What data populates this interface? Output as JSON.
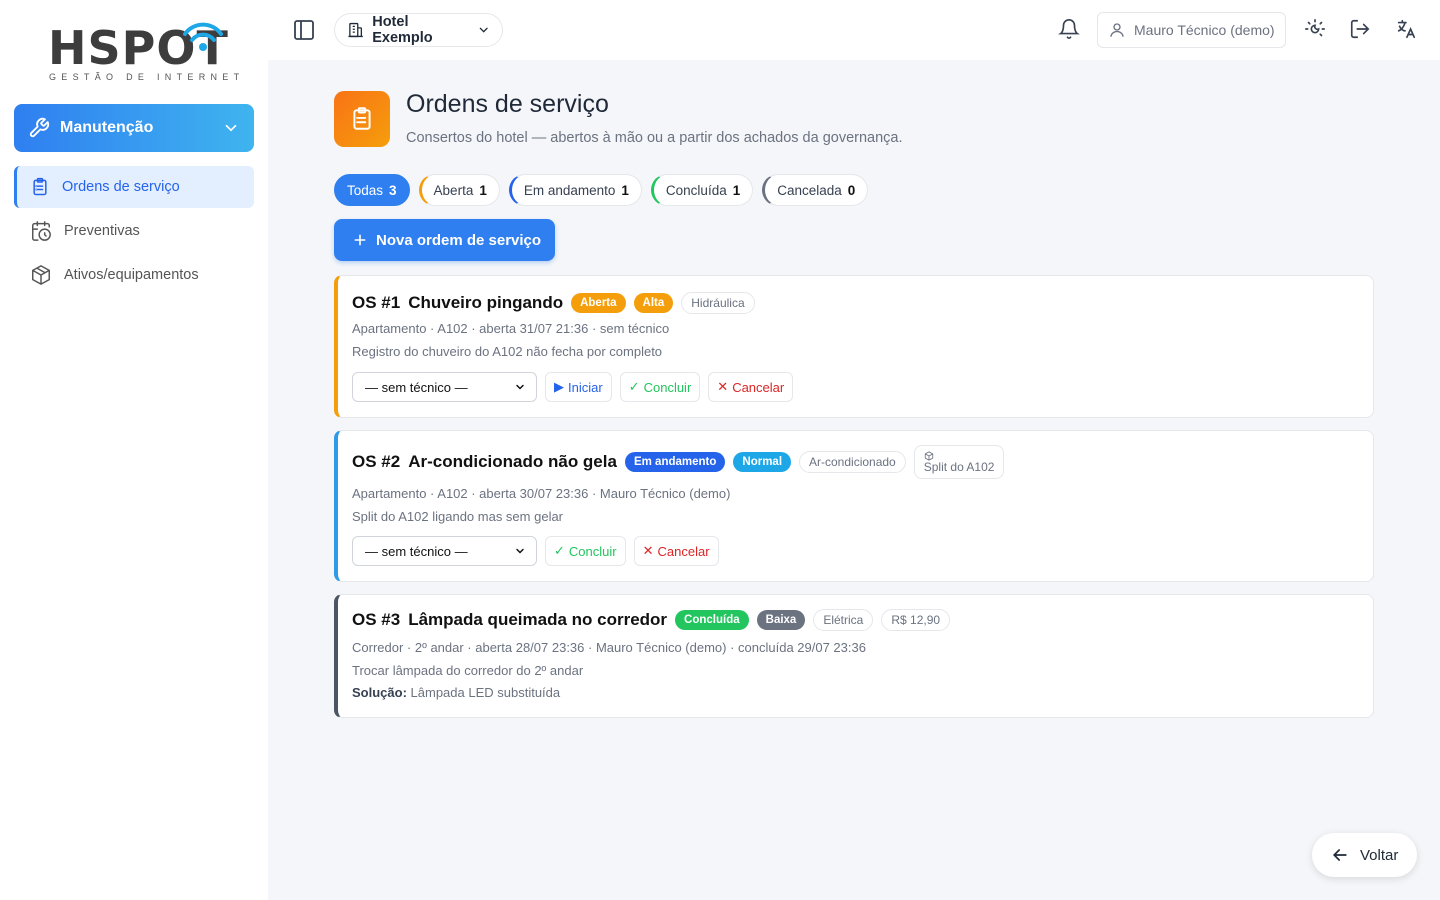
{
  "brand": {
    "name": "HSPOT",
    "tagline": "GESTÃO DE INTERNET"
  },
  "sidebar": {
    "module": "Manutenção",
    "items": [
      {
        "label": "Ordens de serviço",
        "active": true
      },
      {
        "label": "Preventivas",
        "active": false
      },
      {
        "label": "Ativos/equipamentos",
        "active": false
      }
    ]
  },
  "topbar": {
    "hotel": "Hotel Exemplo",
    "user": "Mauro Técnico (demo)"
  },
  "page": {
    "title": "Ordens de serviço",
    "subtitle": "Consertos do hotel — abertos à mão ou a partir dos achados da governança."
  },
  "filters": [
    {
      "label": "Todas",
      "count": "3"
    },
    {
      "label": "Aberta",
      "count": "1"
    },
    {
      "label": "Em andamento",
      "count": "1"
    },
    {
      "label": "Concluída",
      "count": "1"
    },
    {
      "label": "Cancelada",
      "count": "0"
    }
  ],
  "new_button": "Nova ordem de serviço",
  "orders": [
    {
      "num": "OS #1",
      "title": "Chuveiro pingando",
      "status": "Aberta",
      "priority": "Alta",
      "category": "Hidráulica",
      "meta": "Apartamento · A102 · aberta 31/07 21:36 · sem técnico",
      "description": "Registro do chuveiro do A102 não fecha por completo",
      "technician": "— sem técnico —",
      "actions": {
        "start": "Iniciar",
        "done": "Concluir",
        "cancel": "Cancelar"
      }
    },
    {
      "num": "OS #2",
      "title": "Ar-condicionado não gela",
      "status": "Em andamento",
      "priority": "Normal",
      "category": "Ar-condicionado",
      "asset": "Split do A102",
      "meta": "Apartamento · A102 · aberta 30/07 23:36 · Mauro Técnico (demo)",
      "description": "Split do A102 ligando mas sem gelar",
      "technician": "— sem técnico —",
      "actions": {
        "done": "Concluir",
        "cancel": "Cancelar"
      }
    },
    {
      "num": "OS #3",
      "title": "Lâmpada queimada no corredor",
      "status": "Concluída",
      "priority": "Baixa",
      "category": "Elétrica",
      "cost": "R$ 12,90",
      "meta": "Corredor · 2º andar · aberta 28/07 23:36 · Mauro Técnico (demo) · concluída 29/07 23:36",
      "description": "Trocar lâmpada do corredor do 2º andar",
      "solution_label": "Solução:",
      "solution": "Lâmpada LED substituída"
    }
  ],
  "back_button": "Voltar",
  "colors": {
    "accent": "#2f7ff0",
    "aberta": "#f59e0b",
    "alta": "#f59e0b",
    "andamento": "#2563eb",
    "normal": "#1ea7e6",
    "concluida": "#22c55e",
    "baixa": "#6b7280"
  }
}
